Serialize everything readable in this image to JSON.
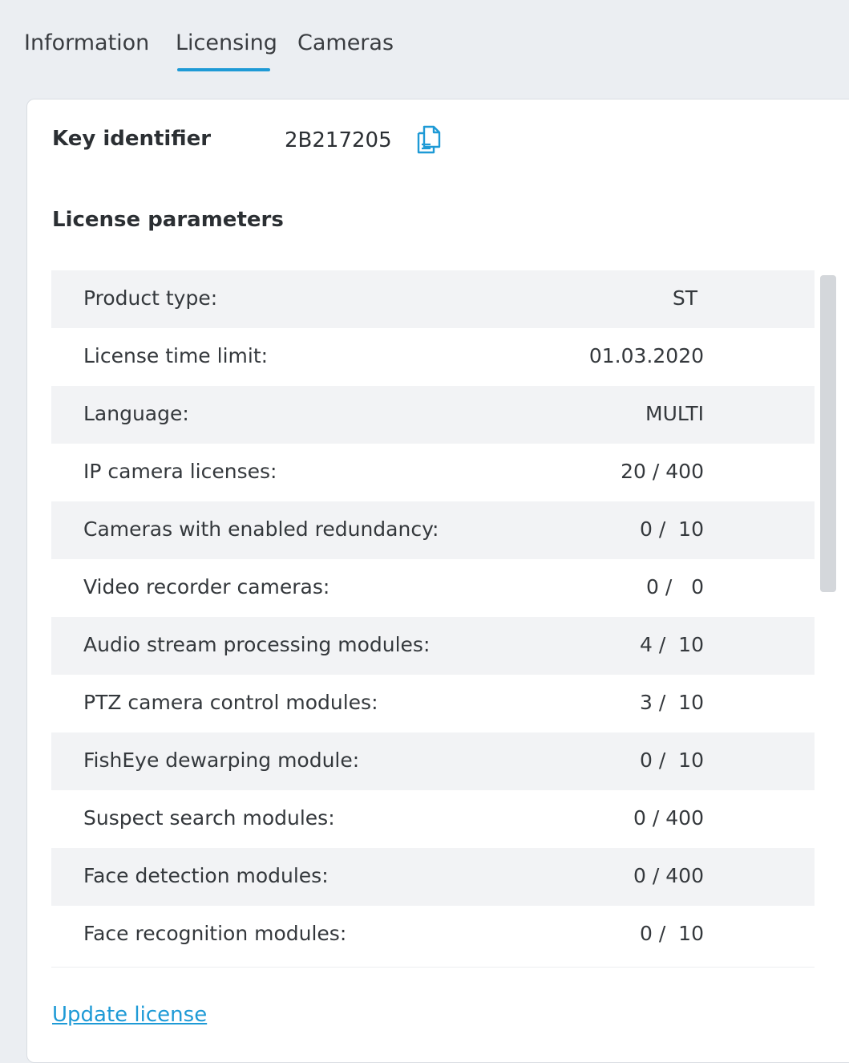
{
  "colors": {
    "accent": "#1e9ad6",
    "page_bg": "#ebeef2",
    "row_alt_bg": "#f2f3f5"
  },
  "tabs": [
    {
      "label": "Information",
      "active": false
    },
    {
      "label": "Licensing",
      "active": true
    },
    {
      "label": "Cameras",
      "active": false
    }
  ],
  "key": {
    "label": "Key identifier",
    "value": "2B217205",
    "copy_icon": "copy-icon"
  },
  "section_title": "License parameters",
  "parameters": [
    {
      "label": "Product type:",
      "value": "ST"
    },
    {
      "label": "License time limit:",
      "value": "01.03.2020"
    },
    {
      "label": "Language:",
      "value": "MULTI"
    },
    {
      "label": "IP camera licenses:",
      "value": "20 / 400"
    },
    {
      "label": "Cameras with enabled redundancy:",
      "value": "0 /  10"
    },
    {
      "label": "Video recorder cameras:",
      "value": "0 /   0"
    },
    {
      "label": "Audio stream processing modules:",
      "value": "4 /  10"
    },
    {
      "label": "PTZ camera control modules:",
      "value": "3 /  10"
    },
    {
      "label": "FishEye dewarping module:",
      "value": "0 /  10"
    },
    {
      "label": "Suspect search modules:",
      "value": "0 / 400"
    },
    {
      "label": "Face detection modules:",
      "value": "0 / 400"
    },
    {
      "label": "Face recognition modules:",
      "value": "0 /  10"
    }
  ],
  "update_link": "Update license"
}
